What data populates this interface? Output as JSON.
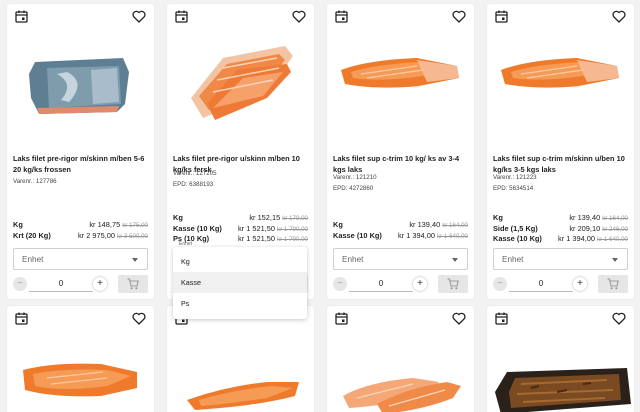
{
  "products": [
    {
      "title": "Laks filet pre-rigor m/skinn m/ben 5-6 20 kg/ks frossen",
      "varenr": "Varenr.: 127786",
      "epd": "",
      "prices": [
        {
          "label": "Kg",
          "price": "kr 148,75",
          "old": "kr 175,00"
        },
        {
          "label": "Krt (20 Kg)",
          "price": "kr 2 975,00",
          "old": "kr 3 500,00"
        }
      ]
    },
    {
      "title": "Laks filet pre-rigor u/skinn m/ben 10 kg/ks fersk",
      "varenr": "Varenr.: 127205",
      "epd": "EPD: 6388193",
      "prices": [
        {
          "label": "Kg",
          "price": "kr 152,15",
          "old": "kr 179,00"
        },
        {
          "label": "Kasse (10 Kg)",
          "price": "kr 1 521,50",
          "old": "kr 1 790,00"
        },
        {
          "label": "Ps (10 Kg)",
          "price": "kr 1 521,50",
          "old": "kr 1 790,00"
        }
      ]
    },
    {
      "title": "Laks filet sup c-trim 10 kg/ ks av 3-4 kgs laks",
      "varenr": "Varenr.: 121210",
      "epd": "EPD: 4272860",
      "prices": [
        {
          "label": "Kg",
          "price": "kr 139,40",
          "old": "kr 164,00"
        },
        {
          "label": "Kasse (10 Kg)",
          "price": "kr 1 394,00",
          "old": "kr 1 640,00"
        }
      ]
    },
    {
      "title": "Laks filet sup c-trim m/skinn u/ben 10 kg/ks 3-5 kgs laks",
      "varenr": "Varenr.: 121223",
      "epd": "EPD: 5634514",
      "prices": [
        {
          "label": "Kg",
          "price": "kr 139,40",
          "old": "kr 164,00"
        },
        {
          "label": "Side (1,5 Kg)",
          "price": "kr 209,10",
          "old": "kr 246,00"
        },
        {
          "label": "Kasse (10 Kg)",
          "price": "kr 1 394,00",
          "old": "kr 1 640,00"
        }
      ]
    }
  ],
  "unit_select": {
    "label": "Enhet",
    "hidden_label": "Enhet"
  },
  "quantity": "0",
  "dropdown": {
    "options": [
      "Kg",
      "Kasse",
      "Ps"
    ],
    "highlighted": "Kasse"
  },
  "icons": {
    "calendar": "calendar-icon",
    "favorite": "heart-outline-icon",
    "cart": "cart-icon",
    "caret": "chevron-down-icon"
  },
  "colors": {
    "background": "#f2f2f2",
    "card": "#ffffff",
    "salmon": "#f0803c",
    "disabled": "#e6e6e6"
  }
}
